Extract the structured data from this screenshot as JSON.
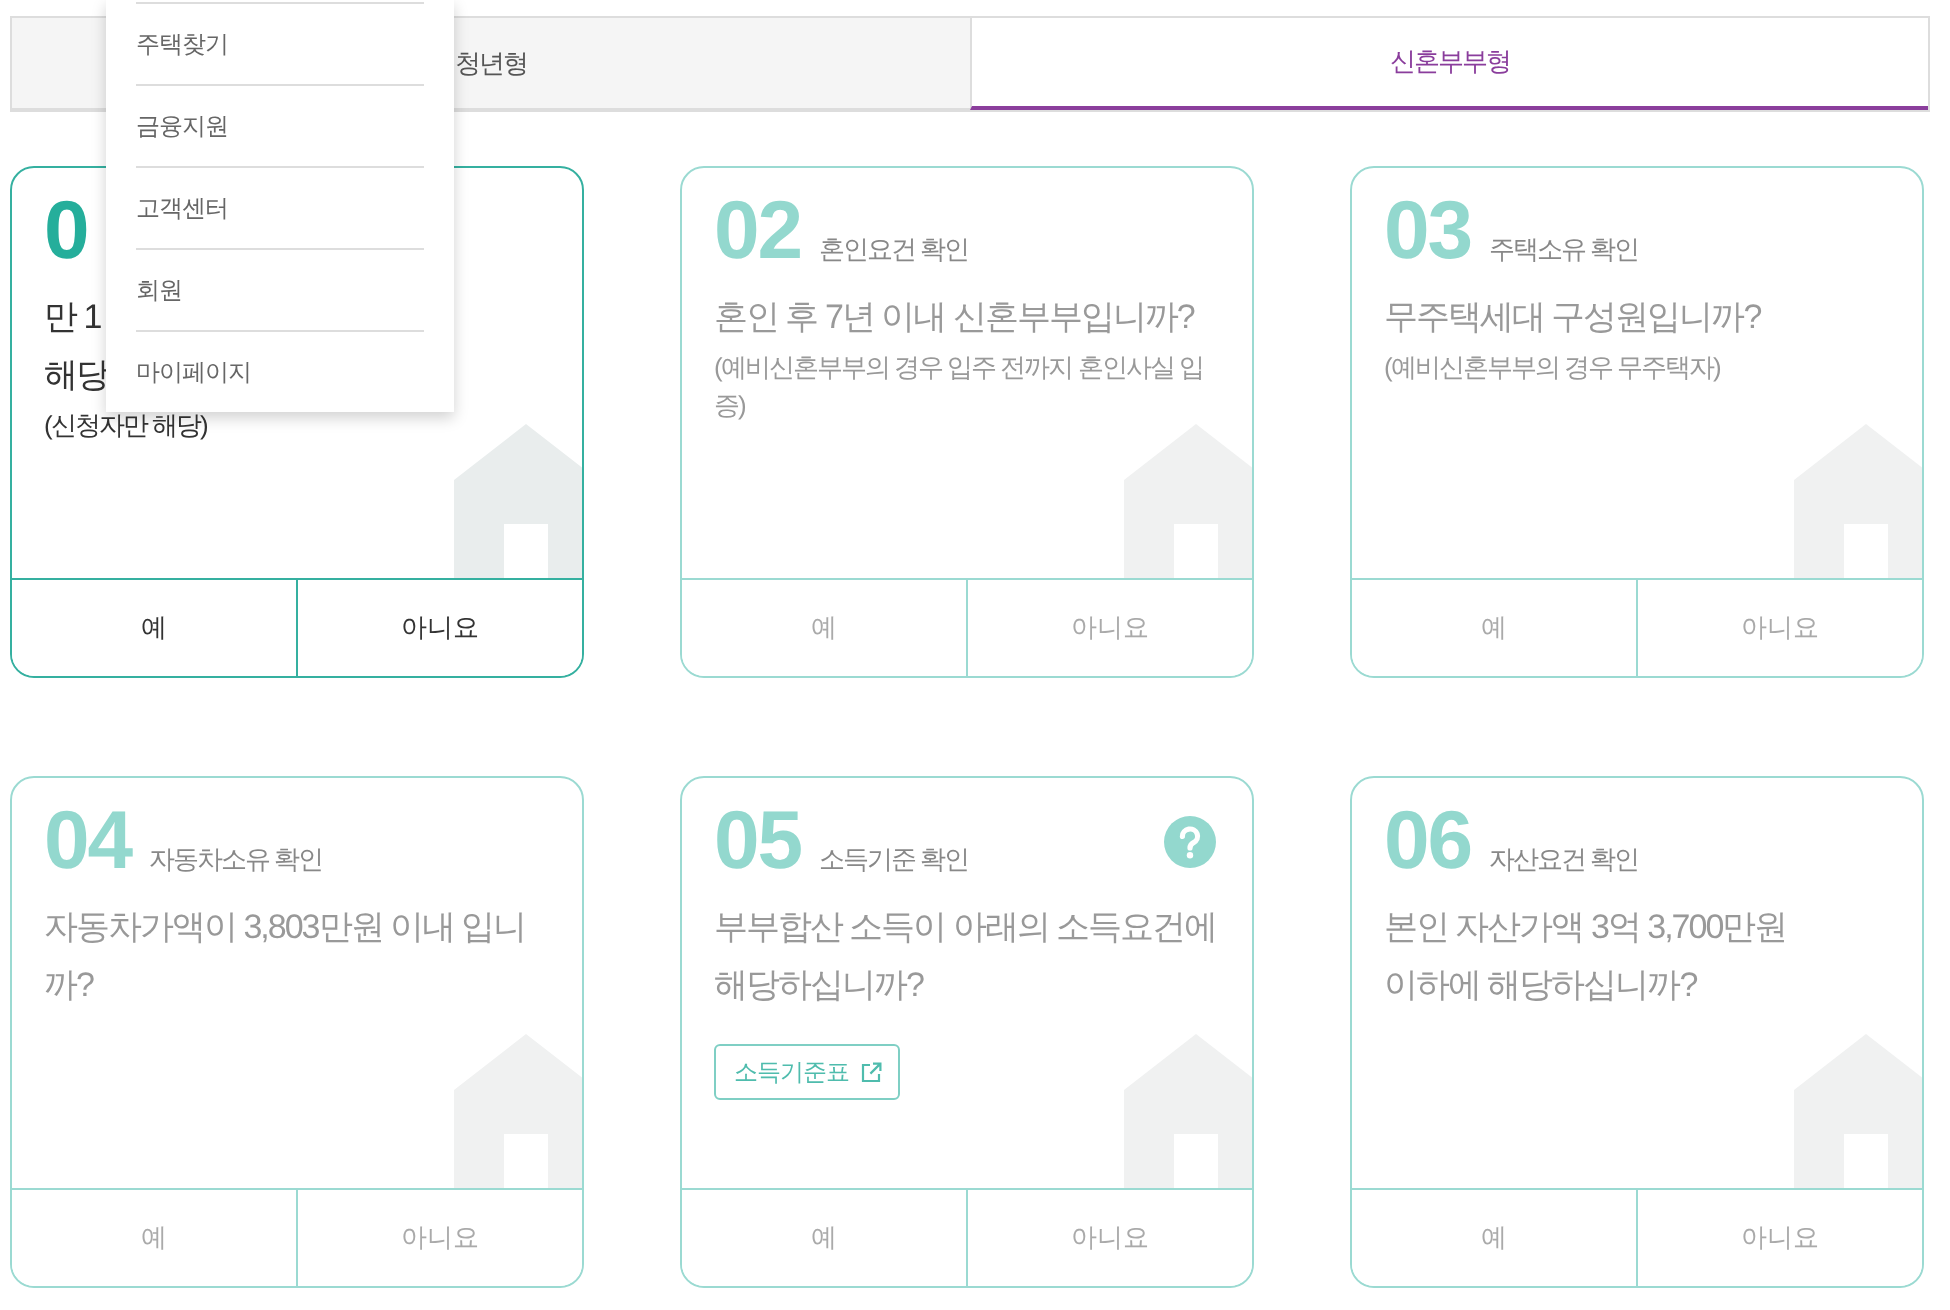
{
  "tabs": [
    {
      "label": "청년형",
      "selected": false
    },
    {
      "label": "신혼부부형",
      "selected": true
    }
  ],
  "cards": [
    {
      "number": "0",
      "active": true,
      "help": false,
      "question": [
        "만 1",
        "해당"
      ],
      "note": [
        "(신청자만 해당)"
      ],
      "answers": [
        "예",
        "아니요"
      ]
    },
    {
      "number": "02",
      "title": "혼인요건 확인",
      "active": false,
      "help": false,
      "question": [
        "혼인 후 7년 이내 신혼부부입니까?"
      ],
      "note": [
        "(예비신혼부부의 경우 입주 전까지 혼인사실 입",
        "증)"
      ],
      "answers": [
        "예",
        "아니요"
      ]
    },
    {
      "number": "03",
      "title": "주택소유 확인",
      "active": false,
      "help": false,
      "question": [
        "무주택세대 구성원입니까?"
      ],
      "note": [
        "(예비신혼부부의 경우 무주택자)"
      ],
      "answers": [
        "예",
        "아니요"
      ]
    },
    {
      "number": "04",
      "title": "자동차소유 확인",
      "active": false,
      "help": false,
      "question": [
        "자동차가액이 3,803만원 이내 입니",
        "까?"
      ],
      "answers": [
        "예",
        "아니요"
      ]
    },
    {
      "number": "05",
      "title": "소득기준 확인",
      "active": false,
      "help": true,
      "question": [
        "부부합산 소득이 아래의 소득요건에",
        "해당하십니까?"
      ],
      "link": {
        "label": "소득기준표"
      },
      "answers": [
        "예",
        "아니요"
      ]
    },
    {
      "number": "06",
      "title": "자산요건 확인",
      "active": false,
      "help": false,
      "question": [
        "본인 자산가액 3억 3,700만원",
        "이하에 해당하십니까?"
      ],
      "answers": [
        "예",
        "아니요"
      ]
    }
  ],
  "menu": {
    "items": [
      "주택찾기",
      "금융지원",
      "고객센터",
      "회원",
      "마이페이지"
    ]
  }
}
